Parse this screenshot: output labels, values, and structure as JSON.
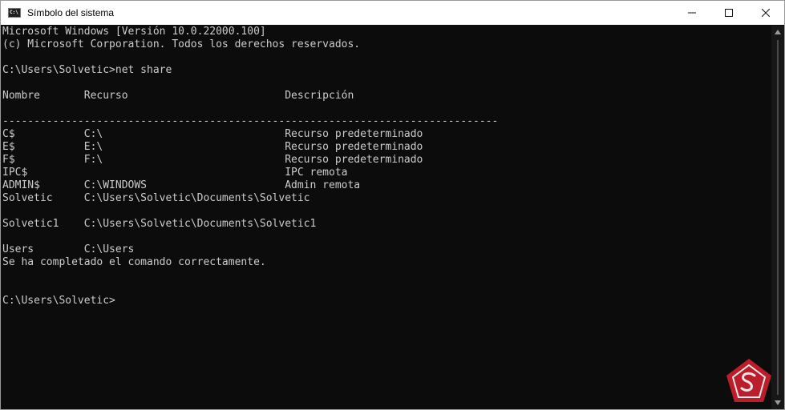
{
  "window": {
    "title": "Símbolo del sistema",
    "icon": "cmd-icon",
    "controls": [
      "minimize-icon",
      "maximize-icon",
      "close-icon"
    ]
  },
  "console": {
    "lines": [
      "Microsoft Windows [Versión 10.0.22000.100]",
      "(c) Microsoft Corporation. Todos los derechos reservados.",
      "",
      "C:\\Users\\Solvetic>net share",
      "",
      "Nombre       Recurso                         Descripción",
      "",
      "-------------------------------------------------------------------------------",
      "C$           C:\\                             Recurso predeterminado",
      "E$           E:\\                             Recurso predeterminado",
      "F$           F:\\                             Recurso predeterminado",
      "IPC$                                         IPC remota",
      "ADMIN$       C:\\WINDOWS                      Admin remota",
      "Solvetic     C:\\Users\\Solvetic\\Documents\\Solvetic",
      "",
      "Solvetic1    C:\\Users\\Solvetic\\Documents\\Solvetic1",
      "",
      "Users        C:\\Users",
      "Se ha completado el comando correctamente.",
      "",
      "",
      "C:\\Users\\Solvetic>"
    ]
  },
  "watermark": {
    "name": "solvetic-logo-icon",
    "colors": {
      "red": "#d01f2e",
      "white": "#ffffff"
    }
  }
}
